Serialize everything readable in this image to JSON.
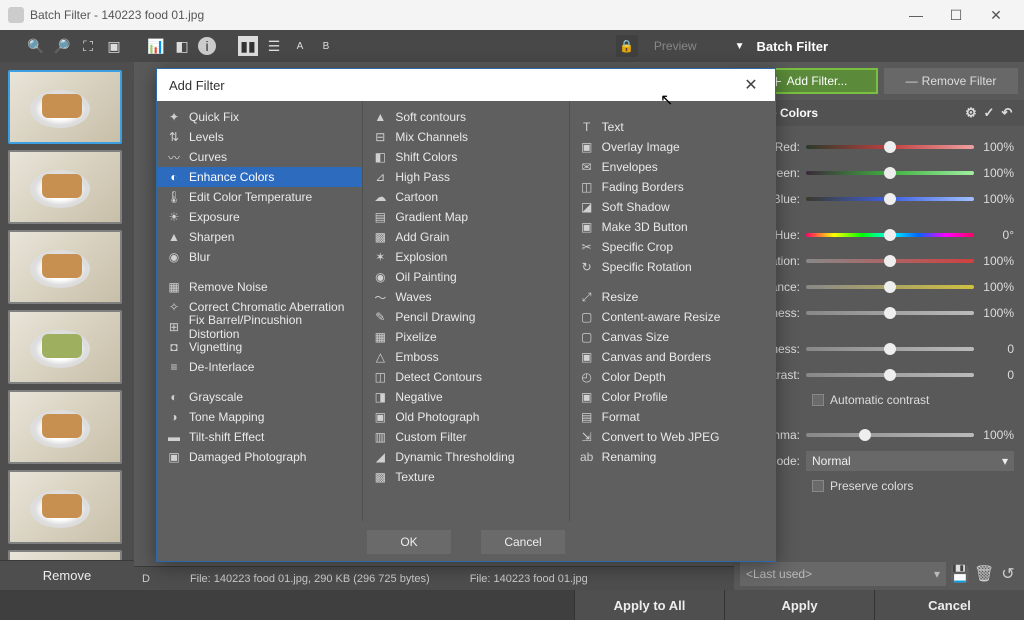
{
  "window": {
    "title": "Batch Filter - 140223 food 01.jpg"
  },
  "toolbar": {
    "preview": "Preview",
    "panel_title": "Batch Filter"
  },
  "thumbs": {
    "remove": "Remove"
  },
  "right": {
    "add_filter": "Add Filter...",
    "remove_filter": "Remove Filter",
    "filter_name": "nance Colors",
    "sliders": {
      "red": {
        "label": "Red:",
        "value": "100%",
        "pos": 50
      },
      "green": {
        "label": "Green:",
        "value": "100%",
        "pos": 50
      },
      "blue": {
        "label": "Blue:",
        "value": "100%",
        "pos": 50
      },
      "hue": {
        "label": "Hue:",
        "value": "0°",
        "pos": 50
      },
      "sat": {
        "label": "turation:",
        "value": "100%",
        "pos": 50
      },
      "vib": {
        "label": "Vibrance:",
        "value": "100%",
        "pos": 50
      },
      "light": {
        "label": "Lightness:",
        "value": "100%",
        "pos": 50
      },
      "bright": {
        "label": "rightness:",
        "value": "0",
        "pos": 50
      },
      "contr": {
        "label": "Contrast:",
        "value": "0",
        "pos": 50
      },
      "gamma": {
        "label": "Gamma:",
        "value": "100%",
        "pos": 35
      }
    },
    "auto_contrast": "Automatic contrast",
    "mode_label": "Mode:",
    "mode_value": "Normal",
    "preserve": "Preserve colors",
    "last_used": "<Last used>"
  },
  "status": {
    "left": "File: 140223 food 01.jpg, 290 KB (296 725 bytes)",
    "right": "File: 140223 food 01.jpg",
    "d_prefix": "D"
  },
  "footer": {
    "apply_all": "Apply to All",
    "apply": "Apply",
    "cancel": "Cancel"
  },
  "dialog": {
    "title": "Add Filter",
    "ok": "OK",
    "cancel": "Cancel",
    "col1": [
      {
        "icon": "✦",
        "label": "Quick Fix"
      },
      {
        "icon": "⇅",
        "label": "Levels"
      },
      {
        "icon": "〰",
        "label": "Curves"
      },
      {
        "icon": "◐",
        "label": "Enhance Colors",
        "selected": true
      },
      {
        "icon": "🌡",
        "label": "Edit Color Temperature"
      },
      {
        "icon": "☀",
        "label": "Exposure"
      },
      {
        "icon": "▲",
        "label": "Sharpen"
      },
      {
        "icon": "◉",
        "label": "Blur"
      },
      {
        "divider": true
      },
      {
        "icon": "▦",
        "label": "Remove Noise"
      },
      {
        "icon": "✧",
        "label": "Correct Chromatic Aberration"
      },
      {
        "icon": "⊞",
        "label": "Fix Barrel/Pincushion Distortion"
      },
      {
        "icon": "◘",
        "label": "Vignetting"
      },
      {
        "icon": "≡",
        "label": "De-Interlace"
      },
      {
        "divider": true
      },
      {
        "icon": "◐",
        "label": "Grayscale"
      },
      {
        "icon": "◑",
        "label": "Tone Mapping"
      },
      {
        "icon": "▬",
        "label": "Tilt-shift Effect"
      },
      {
        "icon": "▣",
        "label": "Damaged Photograph"
      }
    ],
    "col2": [
      {
        "icon": "▲",
        "label": "Soft contours"
      },
      {
        "icon": "⊟",
        "label": "Mix Channels"
      },
      {
        "icon": "◧",
        "label": "Shift Colors"
      },
      {
        "icon": "⊿",
        "label": "High Pass"
      },
      {
        "icon": "☁",
        "label": "Cartoon"
      },
      {
        "icon": "▤",
        "label": "Gradient Map"
      },
      {
        "icon": "▩",
        "label": "Add Grain"
      },
      {
        "icon": "✶",
        "label": "Explosion"
      },
      {
        "icon": "◉",
        "label": "Oil Painting"
      },
      {
        "icon": "〜",
        "label": "Waves"
      },
      {
        "icon": "✎",
        "label": "Pencil Drawing"
      },
      {
        "icon": "▦",
        "label": "Pixelize"
      },
      {
        "icon": "△",
        "label": "Emboss"
      },
      {
        "icon": "◫",
        "label": "Detect Contours"
      },
      {
        "icon": "◨",
        "label": "Negative"
      },
      {
        "icon": "▣",
        "label": "Old Photograph"
      },
      {
        "icon": "▥",
        "label": "Custom Filter"
      },
      {
        "icon": "◢",
        "label": "Dynamic Thresholding"
      },
      {
        "icon": "▩",
        "label": "Texture"
      }
    ],
    "col3": [
      {
        "divider": true
      },
      {
        "icon": "T",
        "label": "Text"
      },
      {
        "icon": "▣",
        "label": "Overlay Image"
      },
      {
        "icon": "✉",
        "label": "Envelopes"
      },
      {
        "icon": "◫",
        "label": "Fading Borders"
      },
      {
        "icon": "◪",
        "label": "Soft Shadow"
      },
      {
        "icon": "▣",
        "label": "Make 3D Button"
      },
      {
        "icon": "✂",
        "label": "Specific Crop"
      },
      {
        "icon": "↻",
        "label": "Specific Rotation"
      },
      {
        "divider": true
      },
      {
        "icon": "⤢",
        "label": "Resize"
      },
      {
        "icon": "▢",
        "label": "Content-aware Resize"
      },
      {
        "icon": "▢",
        "label": "Canvas Size"
      },
      {
        "icon": "▣",
        "label": "Canvas and Borders"
      },
      {
        "icon": "◴",
        "label": "Color Depth"
      },
      {
        "icon": "▣",
        "label": "Color Profile"
      },
      {
        "icon": "▤",
        "label": "Format"
      },
      {
        "icon": "⇲",
        "label": "Convert to Web JPEG"
      },
      {
        "icon": "ab",
        "label": "Renaming"
      }
    ]
  }
}
